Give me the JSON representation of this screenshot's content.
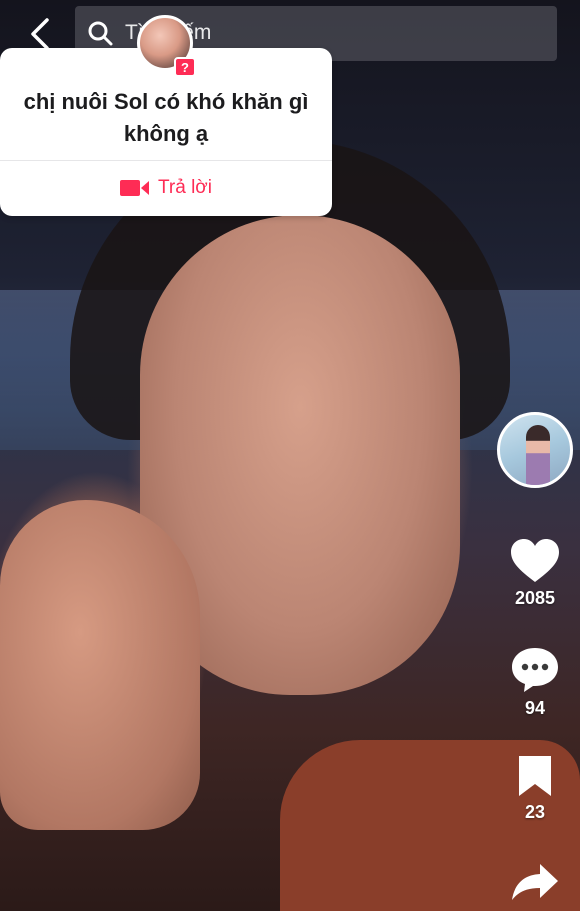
{
  "search": {
    "placeholder": "Tìm kiếm"
  },
  "question_card": {
    "question": "chị nuôi Sol có khó khăn gì không ạ",
    "badge": "?",
    "reply_label": "Trả lời"
  },
  "actions": {
    "likes": "2085",
    "comments": "94",
    "saves": "23"
  },
  "colors": {
    "accent": "#fe2c55",
    "card_bg": "#ffffff",
    "icon": "#ffffff"
  }
}
